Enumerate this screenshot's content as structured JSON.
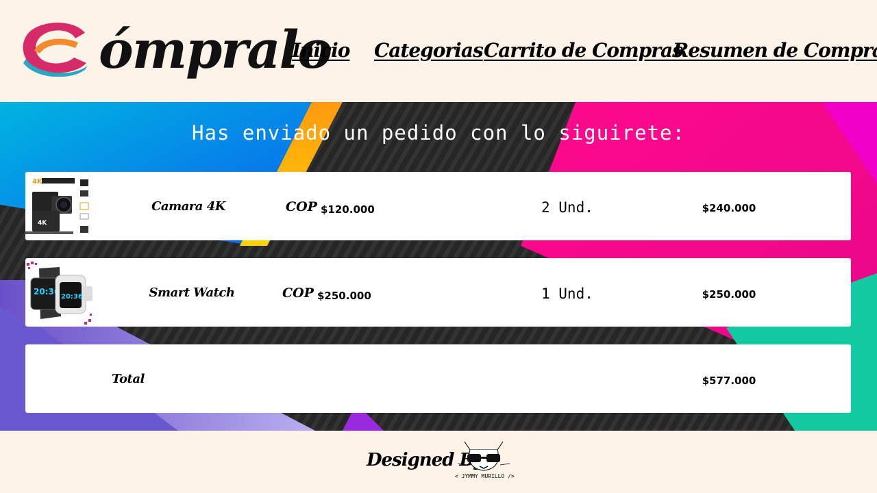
{
  "header": {
    "logo_text": "ómpralo",
    "nav": [
      {
        "label": "Inicio"
      },
      {
        "label": "Categorias"
      },
      {
        "label": "Carrito de Compras"
      },
      {
        "label": "Resumen de Compras"
      }
    ]
  },
  "main": {
    "heading": "Has enviado un pedido con lo siguirete:",
    "items": [
      {
        "name": "Camara 4K",
        "currency": "COP",
        "price": "$120.000",
        "qty": "2 Und.",
        "subtotal": "$240.000",
        "image": "action-camera-image"
      },
      {
        "name": "Smart Watch",
        "currency": "COP",
        "price": "$250.000",
        "qty": "1 Und.",
        "subtotal": "$250.000",
        "image": "smartwatch-image"
      }
    ],
    "total": {
      "label": "Total",
      "value": "$577.000"
    }
  },
  "footer": {
    "designed_by": "Designed By",
    "signature": "< JYMMY MURILLO />"
  },
  "colors": {
    "header_bg": "#fdf3e8",
    "logo_pink": "#d62b68",
    "logo_orange": "#f28a2e",
    "logo_teal": "#2aa7c4",
    "card_bg": "#ffffff"
  }
}
